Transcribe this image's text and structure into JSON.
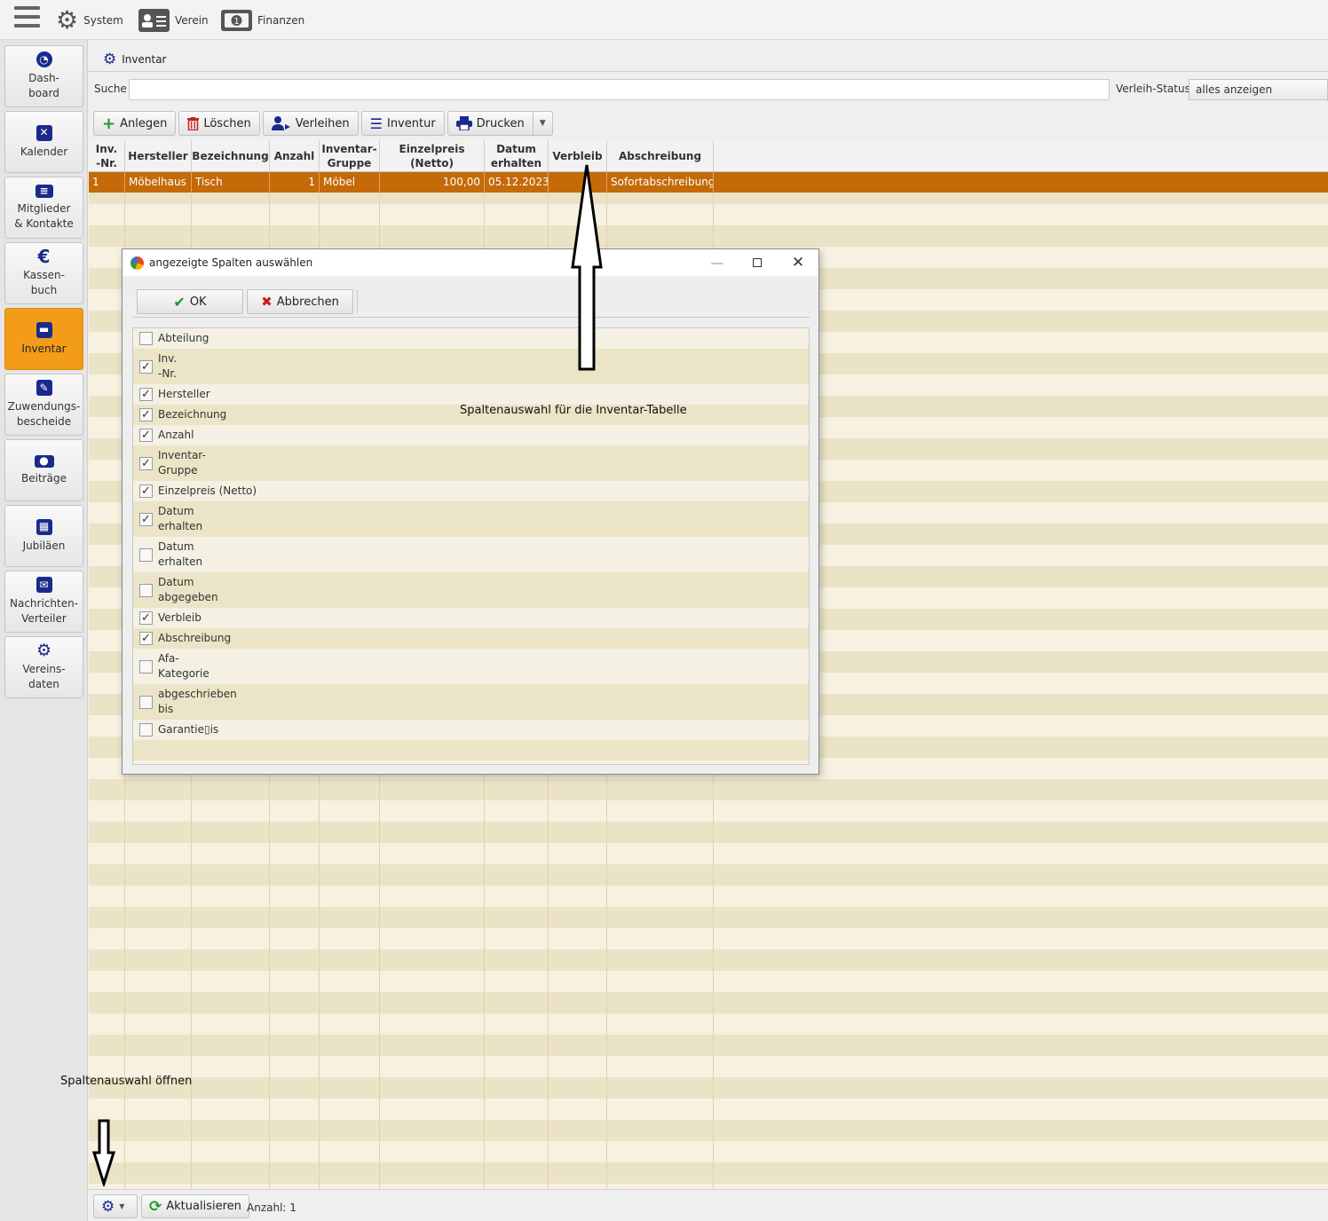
{
  "topmenu": [
    {
      "label": "System",
      "icon": "gear-icon"
    },
    {
      "label": "Verein",
      "icon": "id-card-icon"
    },
    {
      "label": "Finanzen",
      "icon": "money-icon"
    }
  ],
  "sidebar": {
    "items": [
      {
        "l1": "Dash-",
        "l2": "board",
        "icon": "dashboard-icon"
      },
      {
        "l1": "Kalender",
        "l2": "",
        "icon": "calendar-icon"
      },
      {
        "l1": "Mitglieder",
        "l2": "& Kontakte",
        "icon": "contacts-icon"
      },
      {
        "l1": "Kassen-",
        "l2": "buch",
        "icon": "euro-icon"
      },
      {
        "l1": "Inventar",
        "l2": "",
        "icon": "archive-icon"
      },
      {
        "l1": "Zuwendungs-",
        "l2": "bescheide",
        "icon": "document-edit-icon"
      },
      {
        "l1": "Beiträge",
        "l2": "",
        "icon": "money-icon"
      },
      {
        "l1": "Jubiläen",
        "l2": "",
        "icon": "calendar-grid-icon"
      },
      {
        "l1": "Nachrichten-",
        "l2": "Verteiler",
        "icon": "mail-icon"
      },
      {
        "l1": "Vereins-",
        "l2": "daten",
        "icon": "gear-icon"
      }
    ],
    "active": "Inventar"
  },
  "main": {
    "tab_label": "Inventar",
    "search_label": "Suche",
    "search_value": "",
    "status_label": "Verleih-Status",
    "status_value": "alles anzeigen"
  },
  "toolbar": {
    "anlegen": "Anlegen",
    "loeschen": "Löschen",
    "verleihen": "Verleihen",
    "inventur": "Inventur",
    "drucken": "Drucken"
  },
  "table": {
    "columns": [
      {
        "l1": "Inv.",
        "l2": "-Nr."
      },
      {
        "l1": "Hersteller",
        "l2": ""
      },
      {
        "l1": "Bezeichnung",
        "l2": ""
      },
      {
        "l1": "Anzahl",
        "l2": ""
      },
      {
        "l1": "Inventar-",
        "l2": "Gruppe"
      },
      {
        "l1": "Einzelpreis (Netto)",
        "l2": ""
      },
      {
        "l1": "Datum",
        "l2": "erhalten"
      },
      {
        "l1": "Verbleib",
        "l2": ""
      },
      {
        "l1": "Abschreibung",
        "l2": ""
      }
    ],
    "rows": [
      [
        "1",
        "Möbelhaus",
        "Tisch",
        "1",
        "Möbel",
        "100,00",
        "05.12.2023",
        "",
        "Sofortabschreibung"
      ]
    ]
  },
  "dialog": {
    "title": "angezeigte Spalten auswählen",
    "ok_label": "OK",
    "cancel_label": "Abbrechen",
    "options": [
      {
        "l1": "Abteilung",
        "l2": "",
        "checked": false
      },
      {
        "l1": "Inv.",
        "l2": "-Nr.",
        "checked": true
      },
      {
        "l1": "Hersteller",
        "l2": "",
        "checked": true
      },
      {
        "l1": "Bezeichnung",
        "l2": "",
        "checked": true
      },
      {
        "l1": "Anzahl",
        "l2": "",
        "checked": true
      },
      {
        "l1": "Inventar-",
        "l2": "Gruppe",
        "checked": true
      },
      {
        "l1": "Einzelpreis (Netto)",
        "l2": "",
        "checked": true
      },
      {
        "l1": "Datum",
        "l2": "erhalten",
        "checked": true
      },
      {
        "l1": "Datum",
        "l2": "erhalten",
        "checked": false
      },
      {
        "l1": "Datum",
        "l2": "abgegeben",
        "checked": false
      },
      {
        "l1": "Verbleib",
        "l2": "",
        "checked": true
      },
      {
        "l1": "Abschreibung",
        "l2": "",
        "checked": true
      },
      {
        "l1": "Afa-",
        "l2": "Kategorie",
        "checked": false
      },
      {
        "l1": "abgeschrieben",
        "l2": "bis",
        "checked": false
      },
      {
        "l1": "Garantie▯is",
        "l2": "",
        "checked": false
      }
    ]
  },
  "bottombar": {
    "refresh_label": "Aktualisieren",
    "count_text": "Anzahl: 1"
  },
  "annotations": {
    "dialog_note": "Spaltenauswahl für die Inventar-Tabelle",
    "bottom_note": "Spaltenauswahl öffnen"
  }
}
